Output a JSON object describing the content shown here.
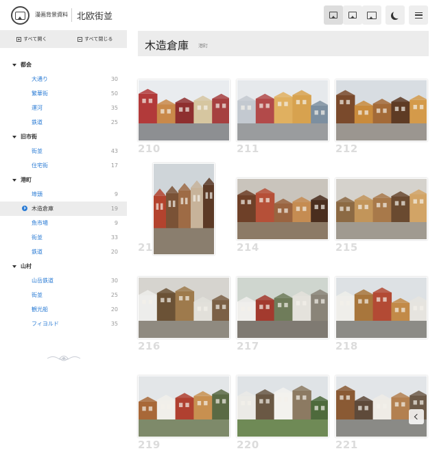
{
  "header": {
    "app_subtitle": "漫画背景資料",
    "app_title": "北欧街並",
    "buttons": [
      {
        "name": "view-small-button",
        "icon": "image-small-icon"
      },
      {
        "name": "view-medium-button",
        "icon": "image-medium-icon"
      },
      {
        "name": "view-large-button",
        "icon": "image-large-icon"
      },
      {
        "name": "dark-mode-button",
        "icon": "moon-icon"
      },
      {
        "name": "menu-button",
        "icon": "hamburger-icon"
      }
    ]
  },
  "sidebar": {
    "expand_all": "すべて開く",
    "collapse_all": "すべて閉じる",
    "groups": [
      {
        "label": "都会",
        "items": [
          {
            "label": "大通り",
            "count": "30"
          },
          {
            "label": "繁華街",
            "count": "50"
          },
          {
            "label": "運河",
            "count": "35"
          },
          {
            "label": "鉄道",
            "count": "25"
          }
        ]
      },
      {
        "label": "旧市街",
        "items": [
          {
            "label": "街並",
            "count": "43"
          },
          {
            "label": "住宅街",
            "count": "17"
          }
        ]
      },
      {
        "label": "港町",
        "items": [
          {
            "label": "埠頭",
            "count": "9"
          },
          {
            "label": "木造倉庫",
            "count": "19",
            "selected": true
          },
          {
            "label": "魚市場",
            "count": "9"
          },
          {
            "label": "街並",
            "count": "33"
          },
          {
            "label": "鉄道",
            "count": "20"
          }
        ]
      },
      {
        "label": "山村",
        "items": [
          {
            "label": "山岳鉄道",
            "count": "30"
          },
          {
            "label": "街並",
            "count": "25"
          },
          {
            "label": "観光船",
            "count": "20"
          },
          {
            "label": "フィヨルド",
            "count": "35"
          }
        ]
      }
    ]
  },
  "main": {
    "title": "木造倉庫",
    "subtitle": "港町",
    "photos": [
      {
        "number": "210",
        "scene": "colorful-wooden-warehouse-row-street"
      },
      {
        "number": "211",
        "scene": "wharf-facades-yellow-building"
      },
      {
        "number": "212",
        "scene": "narrow-wooden-alley"
      },
      {
        "number": "213",
        "scene": "red-stairs-wooden-passage"
      },
      {
        "number": "214",
        "scene": "wooden-courtyard-balcony"
      },
      {
        "number": "215",
        "scene": "covered-wooden-walkway"
      },
      {
        "number": "216",
        "scene": "whitewashed-wall-wooden-door"
      },
      {
        "number": "217",
        "scene": "cobblestone-lane-red-door"
      },
      {
        "number": "218",
        "scene": "white-wall-brown-building"
      },
      {
        "number": "219",
        "scene": "wooden-house-lamp-post"
      },
      {
        "number": "220",
        "scene": "white-storehouse-grass"
      },
      {
        "number": "221",
        "scene": "brown-warehouse-courtyard"
      }
    ]
  },
  "colors": {
    "link": "#2a7bd4",
    "panel": "#ececec",
    "number": "#dcdcdc"
  }
}
